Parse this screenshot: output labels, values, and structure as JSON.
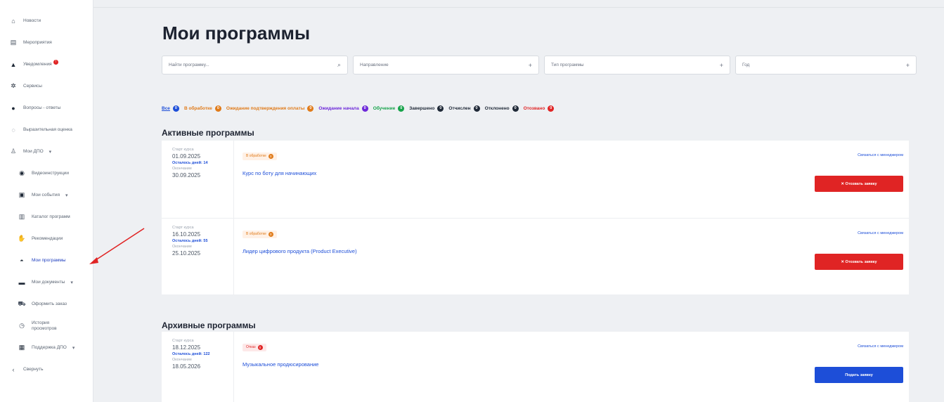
{
  "sidebar": {
    "items": [
      {
        "label": "Новости",
        "icon": "home-icon"
      },
      {
        "label": "Мероприятия",
        "icon": "calendar-icon"
      },
      {
        "label": "Уведомления",
        "icon": "bell-icon",
        "dot": true
      },
      {
        "label": "Сервисы",
        "icon": "gear-icon"
      },
      {
        "label": "Вопросы - ответы",
        "icon": "question-icon"
      },
      {
        "label": "Выразительная оценка",
        "icon": "chat-icon"
      },
      {
        "label": "Мои ДПО",
        "icon": "graduation-icon",
        "expandable": true
      },
      {
        "label": "Видеоинструкции",
        "icon": "video-icon",
        "sub": true
      },
      {
        "label": "Мои события",
        "icon": "events-icon",
        "sub": true,
        "expandable": true
      },
      {
        "label": "Каталог программ",
        "icon": "catalog-icon",
        "sub": true
      },
      {
        "label": "Рекомендации",
        "icon": "thumbs-up-icon",
        "sub": true
      },
      {
        "label": "Мои программы",
        "icon": "cap-icon",
        "sub": true,
        "active": true
      },
      {
        "label": "Мои документы",
        "icon": "folder-icon",
        "sub": true,
        "expandable": true
      },
      {
        "label": "Оформить заказ",
        "icon": "cart-icon",
        "sub": true
      },
      {
        "label": "История",
        "label2": "просмотров",
        "icon": "clock-icon",
        "sub": true
      },
      {
        "label": "Поддержка ДПО",
        "icon": "support-icon",
        "sub": true,
        "expandable": true
      },
      {
        "label": "Свернуть",
        "icon": "chevron-left-icon"
      }
    ],
    "notif_count": "!"
  },
  "page": {
    "title": "Мои программы"
  },
  "filters": {
    "search_placeholder": "Найти программу...",
    "direction": "Направление",
    "type": "Тип программы",
    "year": "Год"
  },
  "chips": [
    {
      "label": "Все",
      "count": "0",
      "color": "#1d4ed8"
    },
    {
      "label": "В обработке",
      "count": "0",
      "color": "#e07b1a"
    },
    {
      "label": "Ожидание подтверждения оплаты",
      "count": "0",
      "color": "#e07b1a"
    },
    {
      "label": "Ожидание начала",
      "count": "0",
      "color": "#6d28d9"
    },
    {
      "label": "Обучение",
      "count": "0",
      "color": "#16a34a"
    },
    {
      "label": "Завершено",
      "count": "0",
      "color": "#1f2937"
    },
    {
      "label": "Отчислен",
      "count": "0",
      "color": "#1f2937"
    },
    {
      "label": "Отклонено",
      "count": "0",
      "color": "#1f2937"
    },
    {
      "label": "Отозвано",
      "count": "0",
      "color": "#e02424"
    }
  ],
  "active": {
    "title": "Активные программы",
    "rows": [
      {
        "start_label": "Старт курса",
        "start": "01.09.2025",
        "left": "Осталось дней: 14",
        "end_label": "Окончание",
        "end": "30.09.2025",
        "badge": "В обработке",
        "badge_count": "0",
        "program": "Курс по боту для начинающих",
        "contact": "Связаться с менеджером",
        "button": "✕  Отозвать заявку"
      },
      {
        "start_label": "Старт курса",
        "start": "16.10.2025",
        "left": "Осталось дней: 55",
        "end_label": "Окончание",
        "end": "25.10.2025",
        "badge": "В обработке",
        "badge_count": "0",
        "program": "Лидер цифрового продукта (Product Executive)",
        "contact": "Связаться с менеджером",
        "button": "✕  Отозвать заявку"
      }
    ]
  },
  "archive": {
    "title": "Архивные программы",
    "rows": [
      {
        "start_label": "Старт курса",
        "start": "18.12.2025",
        "left": "Осталось дней: 122",
        "end_label": "Окончание",
        "end": "18.05.2026",
        "badge": "Отказ",
        "badge_count": "0",
        "program": "Музыкальное продюсирование",
        "contact": "Связаться с менеджером",
        "button": "Подать заявку"
      }
    ]
  }
}
